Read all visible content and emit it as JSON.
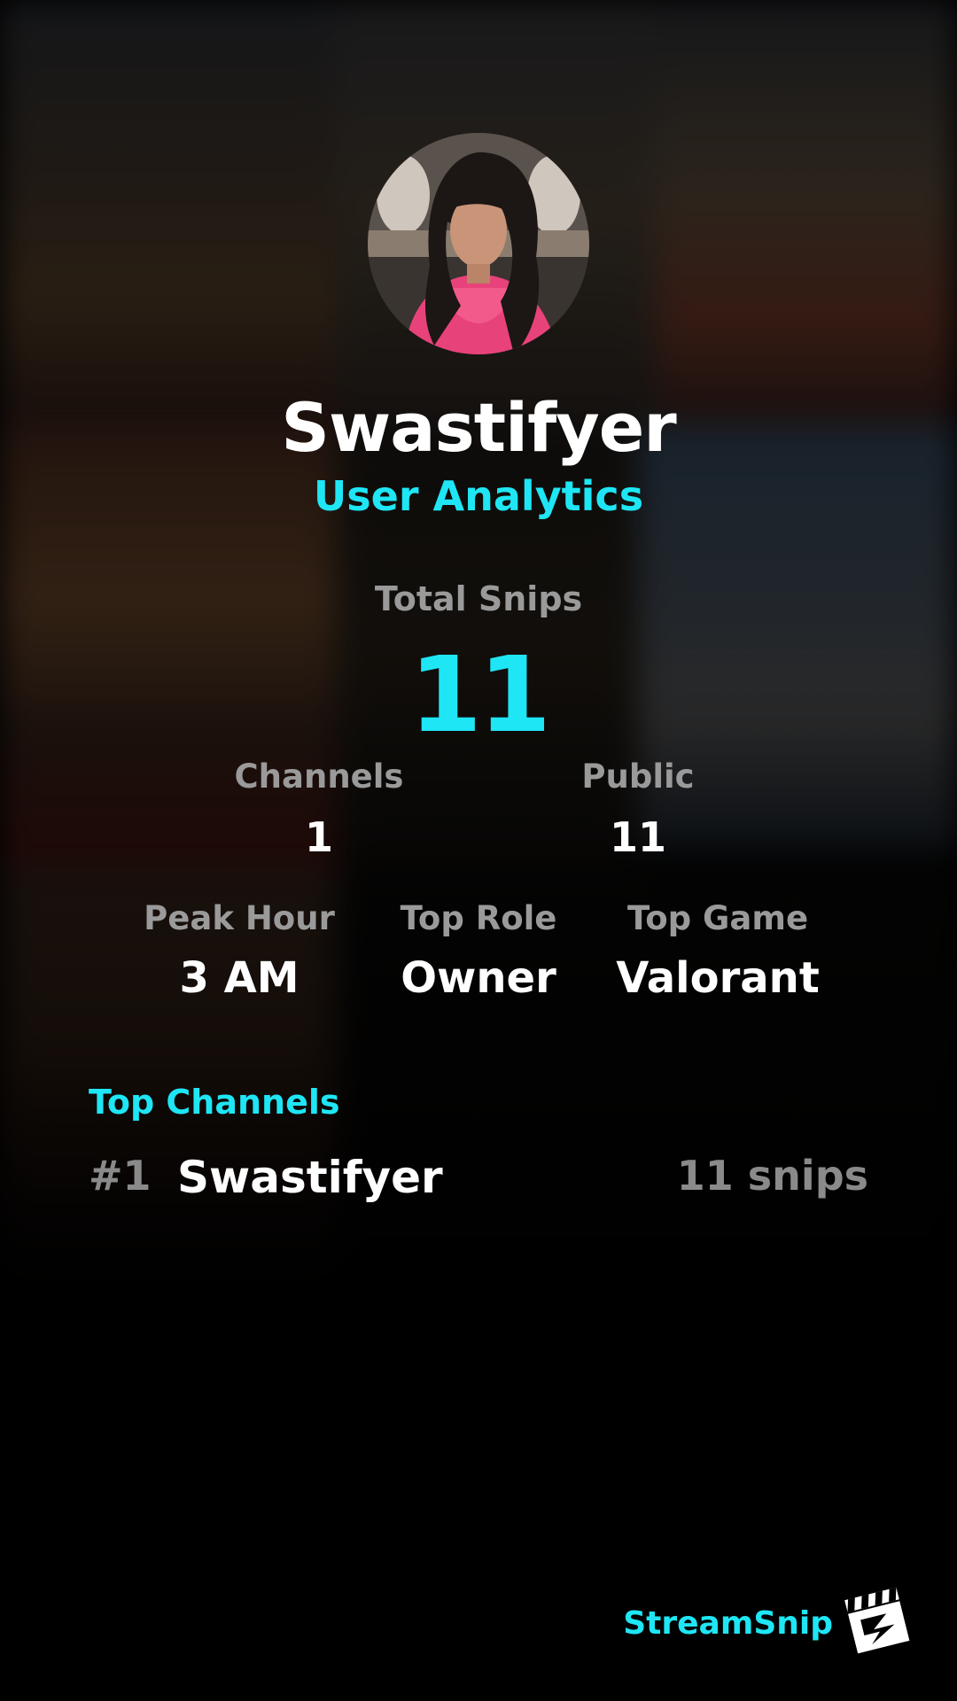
{
  "profile": {
    "username": "Swastifyer",
    "subtitle": "User Analytics"
  },
  "totals": {
    "label": "Total Snips",
    "value": "11"
  },
  "stats_row1": [
    {
      "label": "Channels",
      "value": "1"
    },
    {
      "label": "Public",
      "value": "11"
    }
  ],
  "stats_row2": [
    {
      "label": "Peak Hour",
      "value": "3 AM"
    },
    {
      "label": "Top Role",
      "value": "Owner"
    },
    {
      "label": "Top Game",
      "value": "Valorant"
    }
  ],
  "top_channels": {
    "title": "Top Channels",
    "items": [
      {
        "rank": "#1",
        "name": "Swastifyer",
        "count": "11 snips"
      }
    ]
  },
  "brand": {
    "name": "StreamSnip",
    "logo_icon": "clapperboard-icon"
  },
  "colors": {
    "accent": "#1ee6f5",
    "background": "#000000",
    "primary_text": "#ffffff",
    "muted_text": "#9a9a9a"
  }
}
